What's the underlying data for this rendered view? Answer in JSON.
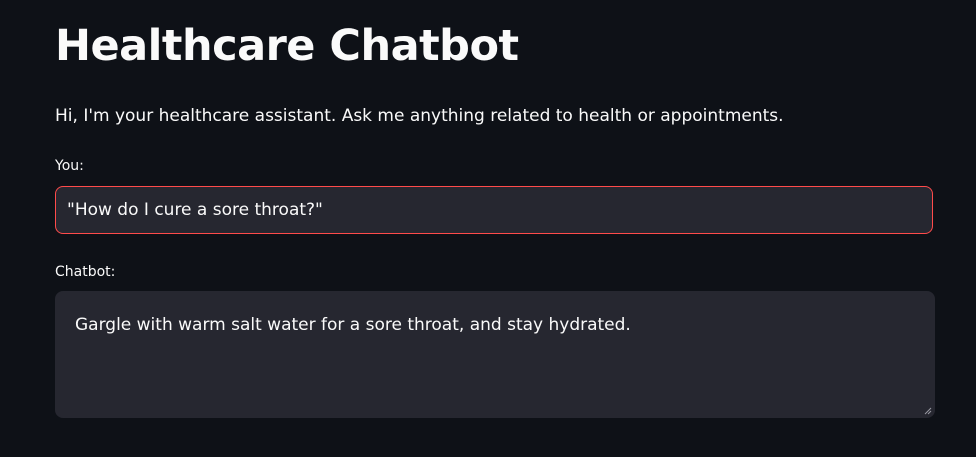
{
  "page": {
    "title": "Healthcare Chatbot",
    "intro": "Hi, I'm your healthcare assistant. Ask me anything related to health or appointments."
  },
  "user_input": {
    "label": "You:",
    "value": "\"How do I cure a sore throat?\""
  },
  "bot_output": {
    "label": "Chatbot:",
    "value": "Gargle with warm salt water for a sore throat, and stay hydrated."
  },
  "icons": {
    "resize": "resize-handle-icon"
  },
  "colors": {
    "background": "#0e1117",
    "field_background": "#262730",
    "focus_border": "#ff4b4b",
    "text": "#fafafa"
  }
}
